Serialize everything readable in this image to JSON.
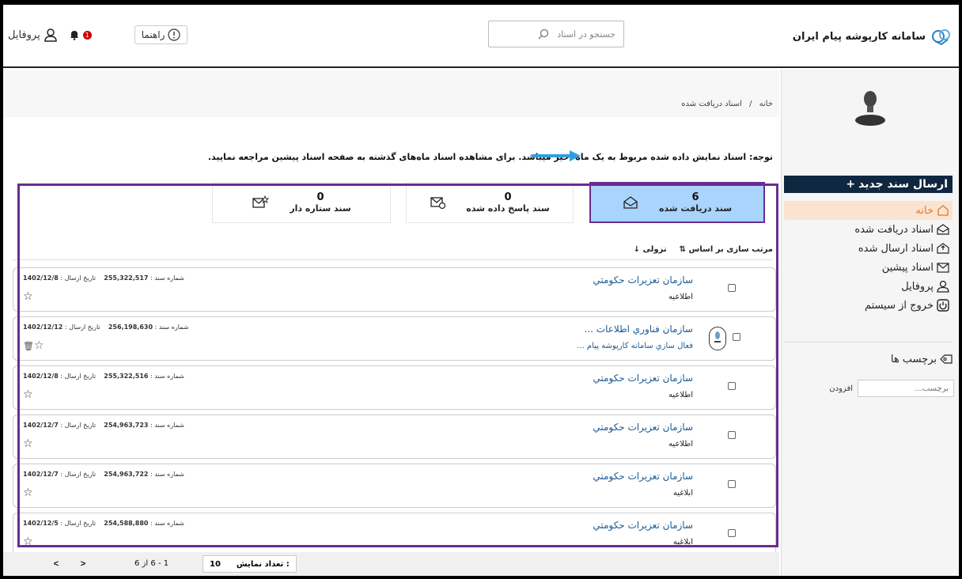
{
  "header": {
    "app_title": "سامانه کارپوشه پیام ایران",
    "search_placeholder": "جستجو در اسناد",
    "help_label": "راهنما",
    "profile_label": "پروفایل",
    "notification_count": "1"
  },
  "sidebar": {
    "new_doc_label": "ارسال سند جدید",
    "items": [
      {
        "label": "خانه",
        "icon": "home-icon",
        "active": true
      },
      {
        "label": "اسناد دریافت شده",
        "icon": "envelope-open-icon"
      },
      {
        "label": "اسناد ارسال شده",
        "icon": "envelope-out-icon"
      },
      {
        "label": "اسناد پیشین",
        "icon": "envelope-archive-icon"
      },
      {
        "label": "پروفایل",
        "icon": "user-icon"
      },
      {
        "label": "خروج از سیستم",
        "icon": "power-icon"
      }
    ],
    "tags_title": "برچسب ها",
    "tag_placeholder": "برچسب...",
    "tag_add_label": "افزودن"
  },
  "breadcrumb": {
    "home": "خانه",
    "separator": "/",
    "current": "اسناد دریافت شده"
  },
  "notice": "توجه: اسناد نمایش داده شده مربوط به یک ماه اخیر میباشد. برای مشاهده اسناد ماه‌های گذشته به صفحه اسناد پیشین مراجعه نمایید.",
  "stats": {
    "received": {
      "count": "6",
      "label": "سند دریافت شده"
    },
    "replied": {
      "count": "0",
      "label": "سند پاسخ داده شده"
    },
    "starred": {
      "count": "0",
      "label": "سند ستاره دار"
    }
  },
  "sort": {
    "label": "مرتب سازی بر اساس",
    "order": "نزولی"
  },
  "documents": [
    {
      "sender": "سازمان تعزيرات حكومتي",
      "subject": "اطلاعیه",
      "doc_number": "255,322,517",
      "date": "1402/12/8"
    },
    {
      "sender": "سازمان فناوري اطلاعات ...",
      "subject": "فعال سازي سامانه کارپوشه پیام ...",
      "doc_number": "256,198,630",
      "date": "1402/12/12"
    },
    {
      "sender": "سازمان تعزيرات حكومتي",
      "subject": "اطلاعیه",
      "doc_number": "255,322,516",
      "date": "1402/12/8"
    },
    {
      "sender": "سازمان تعزيرات حكومتي",
      "subject": "اطلاعیه",
      "doc_number": "254,963,723",
      "date": "1402/12/7"
    },
    {
      "sender": "سازمان تعزيرات حكومتي",
      "subject": "ابلاغیه",
      "doc_number": "254,963,722",
      "date": "1402/12/7"
    },
    {
      "sender": "سازمان تعزيرات حكومتي",
      "subject": "ابلاغیه",
      "doc_number": "254,588,880",
      "date": "1402/12/5"
    }
  ],
  "labels": {
    "doc_number": "شماره سند :",
    "send_date": "تاریخ ارسال :"
  },
  "footer": {
    "range": "1 - 6 از 6",
    "per_page_label": "تعداد نمایش :",
    "per_page_value": "10",
    "prev": "<",
    "next": ">"
  }
}
